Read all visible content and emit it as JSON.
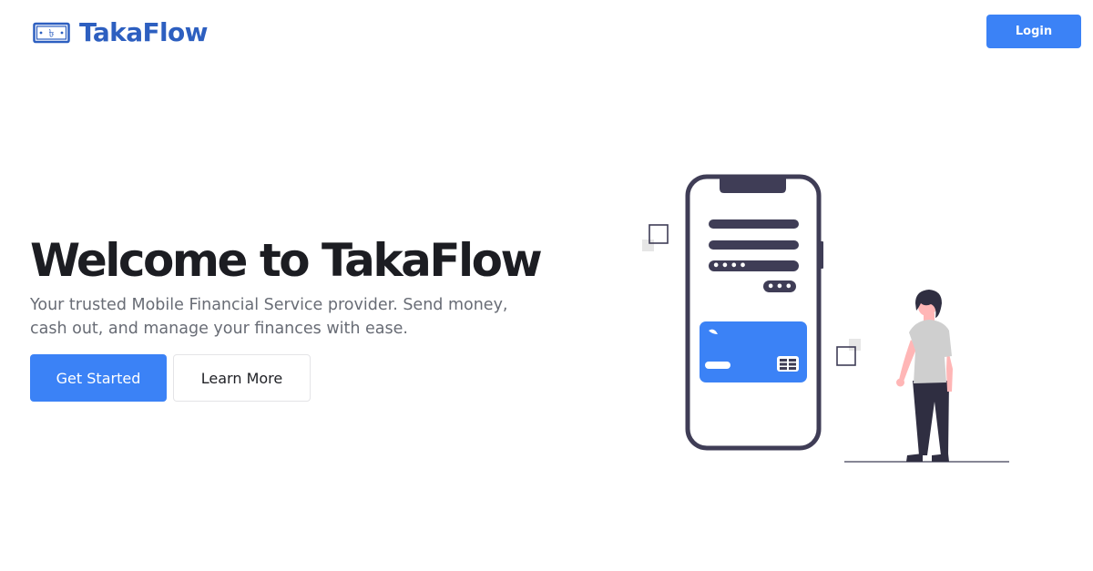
{
  "brand": {
    "name": "TakaFlow",
    "logo_icon": "banknote-taka-icon",
    "logo_symbol": "৳",
    "color": "#2d5fc0"
  },
  "nav": {
    "login_label": "Login"
  },
  "hero": {
    "title": "Welcome to TakaFlow",
    "subtitle": "Your trusted Mobile Financial Service provider. Send money, cash out, and manage your finances with ease.",
    "primary_button": "Get Started",
    "secondary_button": "Learn More"
  },
  "illustration": {
    "name": "person-with-phone-illustration",
    "pin_masked": "••••",
    "otp_masked": "•••"
  },
  "colors": {
    "accent": "#3b82f6",
    "dark": "#3f3d56",
    "text": "#1c1d22",
    "muted": "#686c75"
  }
}
